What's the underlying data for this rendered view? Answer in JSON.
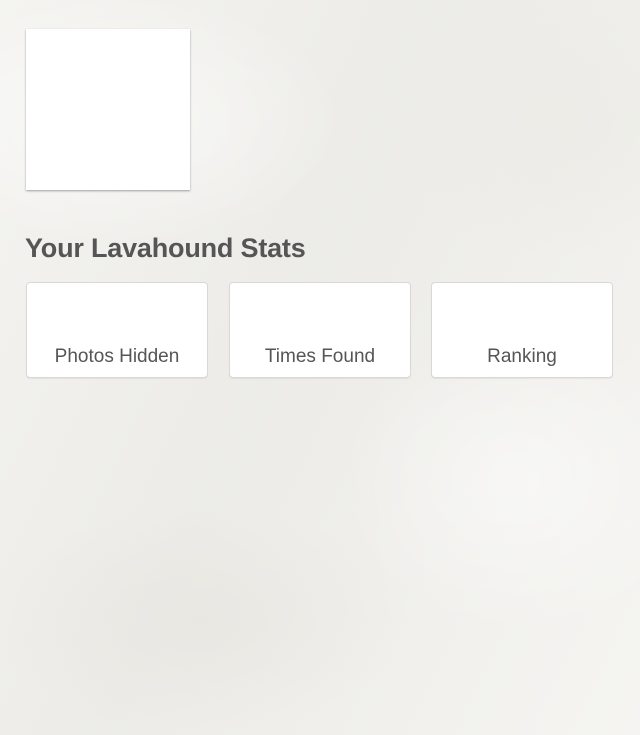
{
  "profile": {
    "stats_title": "Your Lavahound Stats"
  },
  "stats": [
    {
      "label": "Photos Hidden",
      "value": ""
    },
    {
      "label": "Times Found",
      "value": ""
    },
    {
      "label": "Ranking",
      "value": ""
    }
  ]
}
